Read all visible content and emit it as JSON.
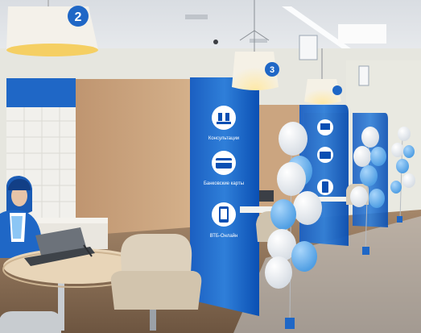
{
  "photo": {
    "lamp_numbers": [
      "2",
      "3"
    ],
    "service_signs": [
      {
        "label": "Консультации",
        "icon": "consultation-icon"
      },
      {
        "label": "Банковские карты",
        "icon": "bank-card-icon"
      },
      {
        "label": "ВТБ-Онлайн",
        "icon": "smartphone-icon"
      }
    ],
    "colors": {
      "brand_blue": "#0a4fb3",
      "light_blue": "#6fb6ef",
      "wood": "#c9a27a",
      "wall": "#ecebe6",
      "floor": "#8a6e52",
      "balloon_white": "#f4f6f8",
      "chair_beige": "#ddd1bd"
    }
  }
}
